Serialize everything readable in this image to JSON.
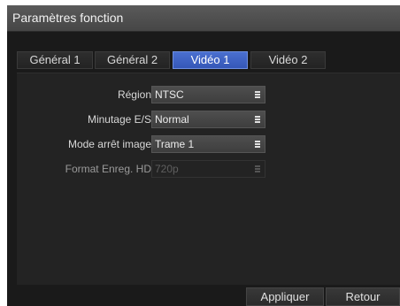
{
  "window": {
    "title": "Paramètres fonction"
  },
  "tabs": [
    {
      "label": "Général 1",
      "active": false
    },
    {
      "label": "Général 2",
      "active": false
    },
    {
      "label": "Vidéo 1",
      "active": true
    },
    {
      "label": "Vidéo 2",
      "active": false
    }
  ],
  "settings": [
    {
      "label": "Région",
      "value": "NTSC",
      "enabled": true
    },
    {
      "label": "Minutage E/S",
      "value": "Normal",
      "enabled": true
    },
    {
      "label": "Mode arrêt image",
      "value": "Trame 1",
      "enabled": true
    },
    {
      "label": "Format Enreg. HD",
      "value": "720p",
      "enabled": false
    }
  ],
  "footer": {
    "apply_label": "Appliquer",
    "back_label": "Retour"
  },
  "colors": {
    "active_tab": "#3d5fc0",
    "background": "#1a1a1a",
    "panel": "#232323"
  },
  "icons": {
    "dropdown": "menu-lines-icon"
  }
}
